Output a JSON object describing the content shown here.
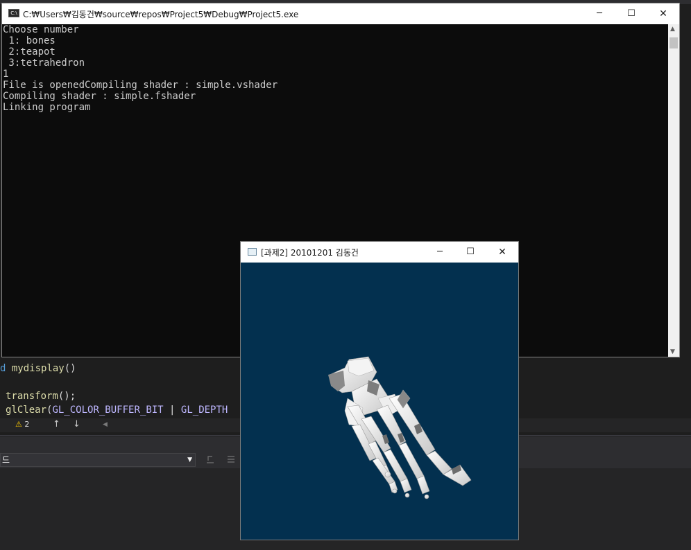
{
  "ide": {
    "code_lines": [
      {
        "keyword": "d",
        "fn": "mydisplay",
        "rest": "()"
      },
      {
        "keyword": "",
        "fn": "",
        "rest": ""
      },
      {
        "keyword": "",
        "fn": "transform",
        "rest": "();"
      },
      {
        "keyword": "",
        "fn": "glClear",
        "rest": "(",
        "macro1": "GL_COLOR_BUFFER_BIT",
        "sep": " | ",
        "macro2": "GL_DEPTH"
      }
    ],
    "warning_count": "2",
    "dropdown_value": "드"
  },
  "console": {
    "title": "C:₩Users₩김동건₩source₩repos₩Project5₩Debug₩Project5.exe",
    "icon_label": "C:\\",
    "lines": [
      "Choose number",
      " 1: bones",
      " 2:teapot",
      " 3:tetrahedron",
      "1",
      "File is openedCompiling shader : simple.vshader",
      "Compiling shader : simple.fshader",
      "Linking program"
    ]
  },
  "glwindow": {
    "title": "[과제2] 20101201 김동건",
    "background_color": "#03304f",
    "model": "bones (foot skeleton)"
  },
  "icons": {
    "minimize": "─",
    "maximize": "☐",
    "close": "✕",
    "warning": "⚠",
    "up": "↑",
    "down": "↓",
    "left": "◀",
    "scroll_up": "▲",
    "scroll_down": "▼",
    "caret": "▼"
  }
}
